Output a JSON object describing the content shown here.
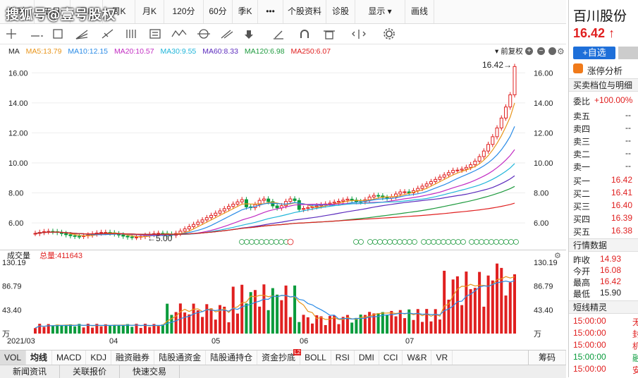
{
  "watermark": "搜狐号@壹号股权",
  "periods": [
    "分时",
    "五日",
    "日K",
    "周K",
    "月K",
    "120分",
    "60分",
    "季K",
    "•••",
    "个股资料",
    "诊股",
    "显示 ▾",
    "画线"
  ],
  "main_panel": {
    "ma_label": "MA",
    "ma5": "MA5:13.79",
    "ma10": "MA10:12.15",
    "ma20": "MA20:10.57",
    "ma30": "MA30:9.55",
    "ma60": "MA60:8.33",
    "ma120": "MA120:6.98",
    "ma250": "MA250:6.07",
    "adjust": "前复权",
    "high_marker": "16.42→",
    "low_marker": "←5.00",
    "limit_badge": "L",
    "q_badge": "Q",
    "y_ticks": [
      "16.00",
      "14.00",
      "12.00",
      "10.00",
      "8.00",
      "6.00"
    ],
    "x_ticks": [
      "2021/03",
      "04",
      "05",
      "06",
      "07"
    ]
  },
  "volume_panel": {
    "title": "成交量",
    "total": "总量:411643",
    "y_ticks": [
      "130.19",
      "86.79",
      "43.40",
      "万"
    ]
  },
  "indicator_tabs": [
    "VOL",
    "均线",
    "MACD",
    "KDJ",
    "融资融券",
    "陆股通资金",
    "陆股通持仓",
    "资金抄底",
    "BOLL",
    "RSI",
    "DMI",
    "CCI",
    "W&R",
    "VR"
  ],
  "indicator_badge": "L2",
  "indicator_extra": "筹码",
  "bottom_tabs": [
    "新闻资讯",
    "关联报价",
    "快速交易"
  ],
  "stock": {
    "name": "百川股份",
    "price": "16.42",
    "arrow": "↑",
    "add_label": "+自选",
    "limit_label": "涨停分析"
  },
  "orderbook": {
    "title": "买卖档位与明细",
    "ratio_label": "委比",
    "ratio_value": "+100.00%",
    "sells": [
      {
        "label": "卖五",
        "value": "--"
      },
      {
        "label": "卖四",
        "value": "--"
      },
      {
        "label": "卖三",
        "value": "--"
      },
      {
        "label": "卖二",
        "value": "--"
      },
      {
        "label": "卖一",
        "value": "--"
      }
    ],
    "buys": [
      {
        "label": "买一",
        "value": "16.42"
      },
      {
        "label": "买二",
        "value": "16.41"
      },
      {
        "label": "买三",
        "value": "16.40"
      },
      {
        "label": "买四",
        "value": "16.39"
      },
      {
        "label": "买五",
        "value": "16.38"
      }
    ]
  },
  "quote": {
    "title": "行情数据",
    "rows": [
      {
        "label": "昨收",
        "value": "14.93"
      },
      {
        "label": "今开",
        "value": "16.08"
      },
      {
        "label": "最高",
        "value": "16.42"
      },
      {
        "label": "最低",
        "value": "15.90"
      }
    ]
  },
  "elf": {
    "title": "短线精灵",
    "rows": [
      {
        "time": "15:00:00",
        "text": "无"
      },
      {
        "time": "15:00:00",
        "text": "封"
      },
      {
        "time": "15:00:00",
        "text": "机"
      },
      {
        "time": "15:00:00",
        "text": "融"
      },
      {
        "time": "15:00:00",
        "text": "安"
      }
    ]
  },
  "colors": {
    "up": "#e02020",
    "down": "#0a9b3c",
    "ma5": "#e8951b",
    "ma10": "#2a8be6",
    "ma20": "#c22cc2",
    "ma30": "#1fb5d9",
    "ma60": "#5b2bbd",
    "ma120": "#1e9a3e",
    "ma250": "#e02020"
  }
}
